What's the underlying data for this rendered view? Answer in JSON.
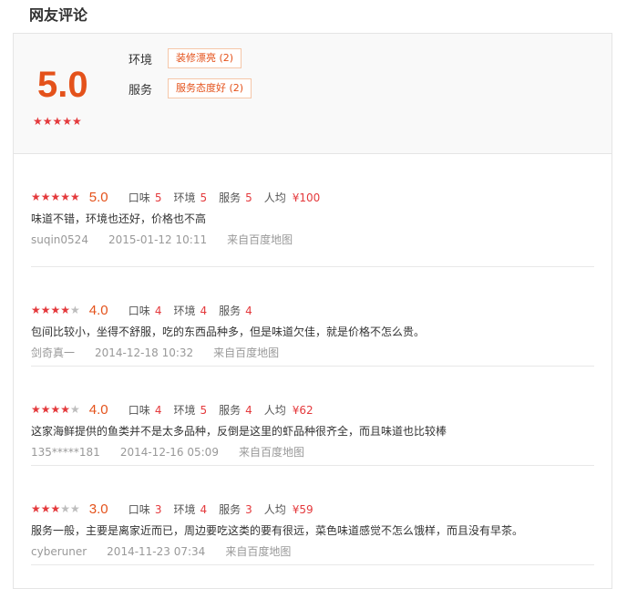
{
  "section_title": "网友评论",
  "summary": {
    "score": "5.0",
    "stars": 5,
    "tags": [
      {
        "category": "环境",
        "label": "装修漂亮 (2)"
      },
      {
        "category": "服务",
        "label": "服务态度好 (2)"
      }
    ]
  },
  "labels": {
    "taste": "口味",
    "env": "环境",
    "service": "服务",
    "avg": "人均"
  },
  "reviews": [
    {
      "stars": 5,
      "score": "5.0",
      "taste": "5",
      "env": "5",
      "service": "5",
      "avg": "¥100",
      "text": "味道不错，环境也还好，价格也不高",
      "user": "suqin0524",
      "time": "2015-01-12 10:11",
      "source": "来自百度地图"
    },
    {
      "stars": 4,
      "score": "4.0",
      "taste": "4",
      "env": "4",
      "service": "4",
      "avg": null,
      "text": "包间比较小，坐得不舒服，吃的东西品种多，但是味道欠佳，就是价格不怎么贵。",
      "user": "剑奇真一",
      "time": "2014-12-18 10:32",
      "source": "来自百度地图"
    },
    {
      "stars": 4,
      "score": "4.0",
      "taste": "4",
      "env": "5",
      "service": "4",
      "avg": "¥62",
      "text": "这家海鲜提供的鱼类并不是太多品种，反倒是这里的虾品种很齐全，而且味道也比较棒",
      "user": "135*****181",
      "time": "2014-12-16 05:09",
      "source": "来自百度地图"
    },
    {
      "stars": 3,
      "score": "3.0",
      "taste": "3",
      "env": "4",
      "service": "3",
      "avg": "¥59",
      "text": "服务一般，主要是离家近而已，周边要吃这类的要有很远，菜色味道感觉不怎么饿样，而且没有早茶。",
      "user": "cyberuner",
      "time": "2014-11-23 07:34",
      "source": "来自百度地图"
    }
  ]
}
